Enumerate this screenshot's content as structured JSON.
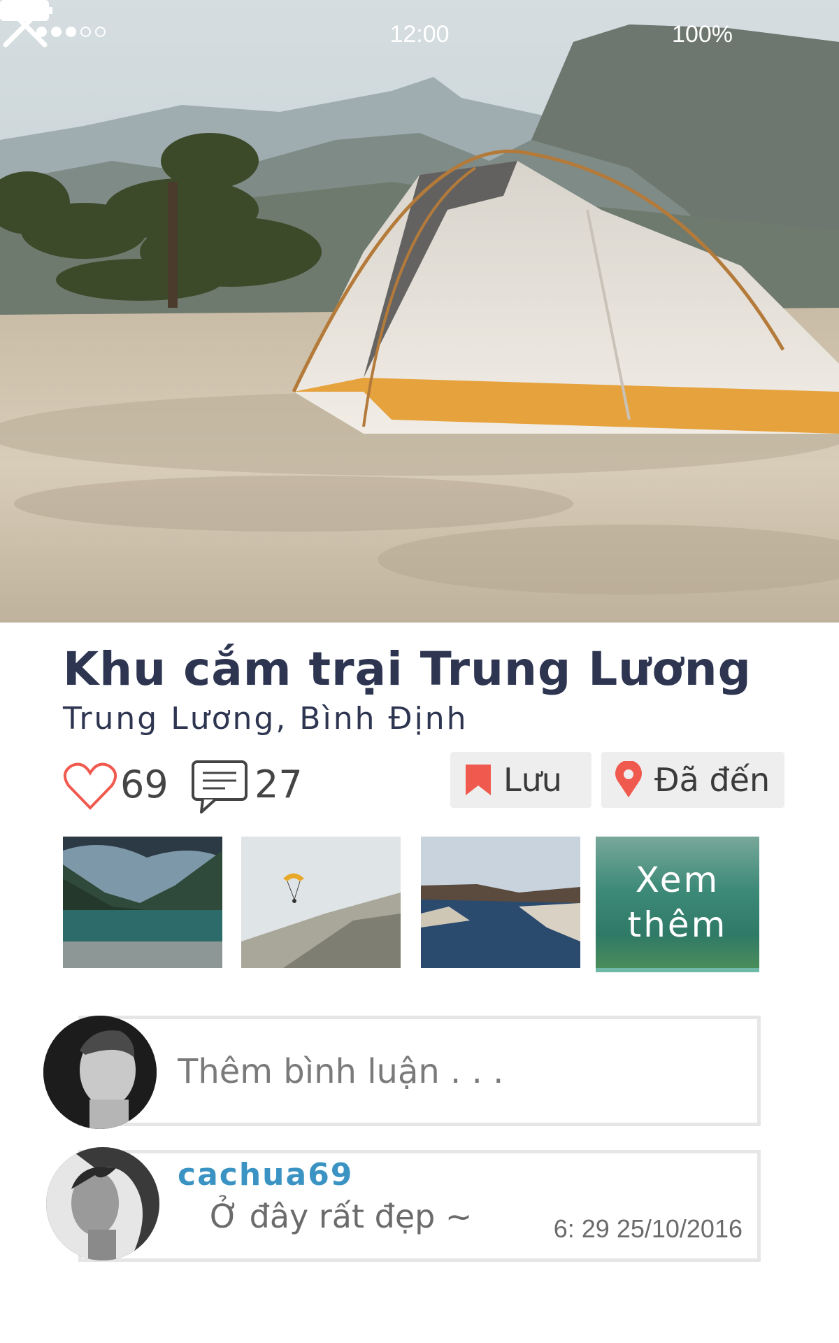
{
  "status_bar": {
    "time": "12:00",
    "battery": "100%",
    "signal_icon": "signal-dots-icon",
    "wifi_icon": "wifi-icon",
    "battery_icon": "battery-icon"
  },
  "hero": {
    "close_icon": "close-icon"
  },
  "place": {
    "title": "Khu cắm trại Trung Lương",
    "location": "Trung Lương, Bình Định"
  },
  "stats": {
    "likes": "69",
    "comments": "27",
    "heart_icon": "heart-icon",
    "comment_icon": "comment-icon"
  },
  "actions": {
    "save_label": "Lưu",
    "been_label": "Đã đến",
    "save_icon": "bookmark-icon",
    "been_icon": "map-pin-icon",
    "save_icon_color": "#f05a4e",
    "been_icon_color": "#f05a4e"
  },
  "gallery": {
    "more_line1": "Xem",
    "more_line2": "thêm"
  },
  "comment_input": {
    "placeholder": "Thêm bình luận . . ."
  },
  "comments": [
    {
      "username": "cachua69",
      "text": "Ở đây rất đẹp ~",
      "time": "6: 29 25/10/2016"
    }
  ],
  "colors": {
    "title": "#2e3550",
    "username": "#3a93c2",
    "heart": "#f05a4e"
  }
}
